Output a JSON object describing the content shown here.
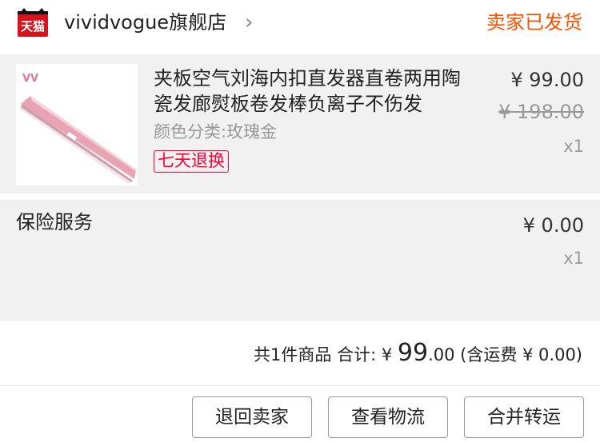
{
  "header": {
    "logo_text": "天猫",
    "store_name": "vividvogue旗舰店",
    "chevron": "›",
    "status": "卖家已发货"
  },
  "product": {
    "title": "夹板空气刘海内扣直发器直卷两用陶瓷发廊熨板卷发棒负离子不伤发",
    "sku": "颜色分类:玫瑰金",
    "badge": "七天退换",
    "price": "¥ 99.00",
    "original_price": "¥ 198.00",
    "quantity": "x1",
    "image_logo": "VV",
    "icon": "hair-straightener-icon"
  },
  "insurance": {
    "label": "保险服务",
    "price": "¥ 0.00",
    "quantity": "x1"
  },
  "summary": {
    "prefix": "共1件商品 合计: ¥ ",
    "amount_int": "99",
    "amount_dec": ".00",
    "shipping": " (含运费 ¥ 0.00)"
  },
  "actions": {
    "return_label": "退回卖家",
    "logistics_label": "查看物流",
    "merge_label": "合并转运"
  },
  "colors": {
    "accent": "#ff5000",
    "badge": "#ff0036",
    "tmall_red": "#d7131d",
    "row_bg": "#f1f1f1"
  }
}
